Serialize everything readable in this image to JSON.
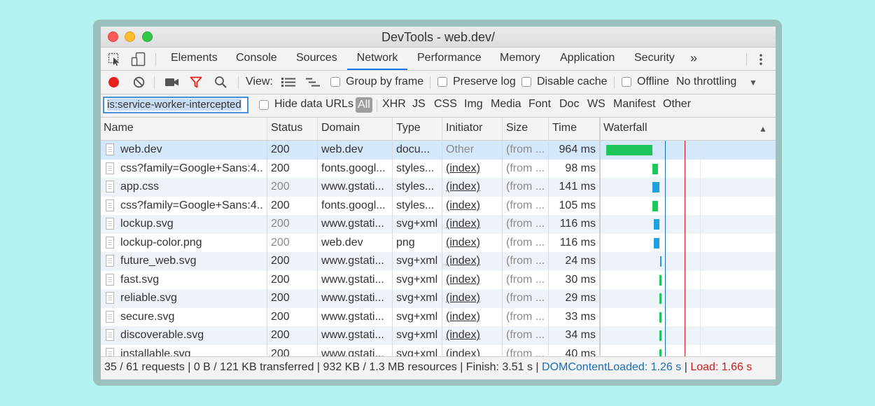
{
  "window": {
    "title": "DevTools - web.dev/"
  },
  "tabs": [
    {
      "label": "Elements"
    },
    {
      "label": "Console"
    },
    {
      "label": "Sources"
    },
    {
      "label": "Network",
      "active": true
    },
    {
      "label": "Performance"
    },
    {
      "label": "Memory"
    },
    {
      "label": "Application"
    },
    {
      "label": "Security"
    }
  ],
  "toolbar": {
    "view_label": "View:",
    "group_by_frame": "Group by frame",
    "preserve_log": "Preserve log",
    "disable_cache": "Disable cache",
    "offline": "Offline",
    "throttling": "No throttling"
  },
  "filter": {
    "value": "is:service-worker-intercepted",
    "hide_data_urls": "Hide data URLs",
    "all": "All",
    "types": [
      "XHR",
      "JS",
      "CSS",
      "Img",
      "Media",
      "Font",
      "Doc",
      "WS",
      "Manifest",
      "Other"
    ]
  },
  "columns": [
    "Name",
    "Status",
    "Domain",
    "Type",
    "Initiator",
    "Size",
    "Time",
    "Waterfall"
  ],
  "rows": [
    {
      "name": "web.dev",
      "status": "200",
      "domain": "web.dev",
      "type": "docu...",
      "initiator": "Other",
      "size": "(from ...",
      "time": "964 ms"
    },
    {
      "name": "css?family=Google+Sans:4...",
      "status": "200",
      "domain": "fonts.googl...",
      "type": "styles...",
      "initiator": "(index)",
      "size": "(from ...",
      "time": "98 ms"
    },
    {
      "name": "app.css",
      "status": "200",
      "domain": "www.gstati...",
      "type": "styles...",
      "initiator": "(index)",
      "size": "(from ...",
      "time": "141 ms"
    },
    {
      "name": "css?family=Google+Sans:4...",
      "status": "200",
      "domain": "fonts.googl...",
      "type": "styles...",
      "initiator": "(index)",
      "size": "(from ...",
      "time": "105 ms"
    },
    {
      "name": "lockup.svg",
      "status": "200",
      "domain": "www.gstati...",
      "type": "svg+xml",
      "initiator": "(index)",
      "size": "(from ...",
      "time": "116 ms"
    },
    {
      "name": "lockup-color.png",
      "status": "200",
      "domain": "web.dev",
      "type": "png",
      "initiator": "(index)",
      "size": "(from ...",
      "time": "116 ms"
    },
    {
      "name": "future_web.svg",
      "status": "200",
      "domain": "www.gstati...",
      "type": "svg+xml",
      "initiator": "(index)",
      "size": "(from ...",
      "time": "24 ms"
    },
    {
      "name": "fast.svg",
      "status": "200",
      "domain": "www.gstati...",
      "type": "svg+xml",
      "initiator": "(index)",
      "size": "(from ...",
      "time": "30 ms"
    },
    {
      "name": "reliable.svg",
      "status": "200",
      "domain": "www.gstati...",
      "type": "svg+xml",
      "initiator": "(index)",
      "size": "(from ...",
      "time": "29 ms"
    },
    {
      "name": "secure.svg",
      "status": "200",
      "domain": "www.gstati...",
      "type": "svg+xml",
      "initiator": "(index)",
      "size": "(from ...",
      "time": "33 ms"
    },
    {
      "name": "discoverable.svg",
      "status": "200",
      "domain": "www.gstati...",
      "type": "svg+xml",
      "initiator": "(index)",
      "size": "(from ...",
      "time": "34 ms"
    },
    {
      "name": "installable.svg",
      "status": "200",
      "domain": "www.gstati...",
      "type": "svg+xml",
      "initiator": "(index)",
      "size": "(from ...",
      "time": "40 ms"
    }
  ],
  "status": {
    "requests": "35 / 61 requests",
    "transferred": "0 B / 121 KB transferred",
    "resources": "932 KB / 1.3 MB resources",
    "finish": "Finish: 3.51 s",
    "dom_content_loaded": "DOMContentLoaded: 1.26 s",
    "load": "Load: 1.66 s"
  },
  "colors": {
    "accent": "#1a73e8",
    "record": "#e8211f",
    "waterfall_green": "#1dc65a",
    "waterfall_blue": "#1ea1e0",
    "dcl_line": "#1a6fb8",
    "load_line": "#c51c1c"
  }
}
